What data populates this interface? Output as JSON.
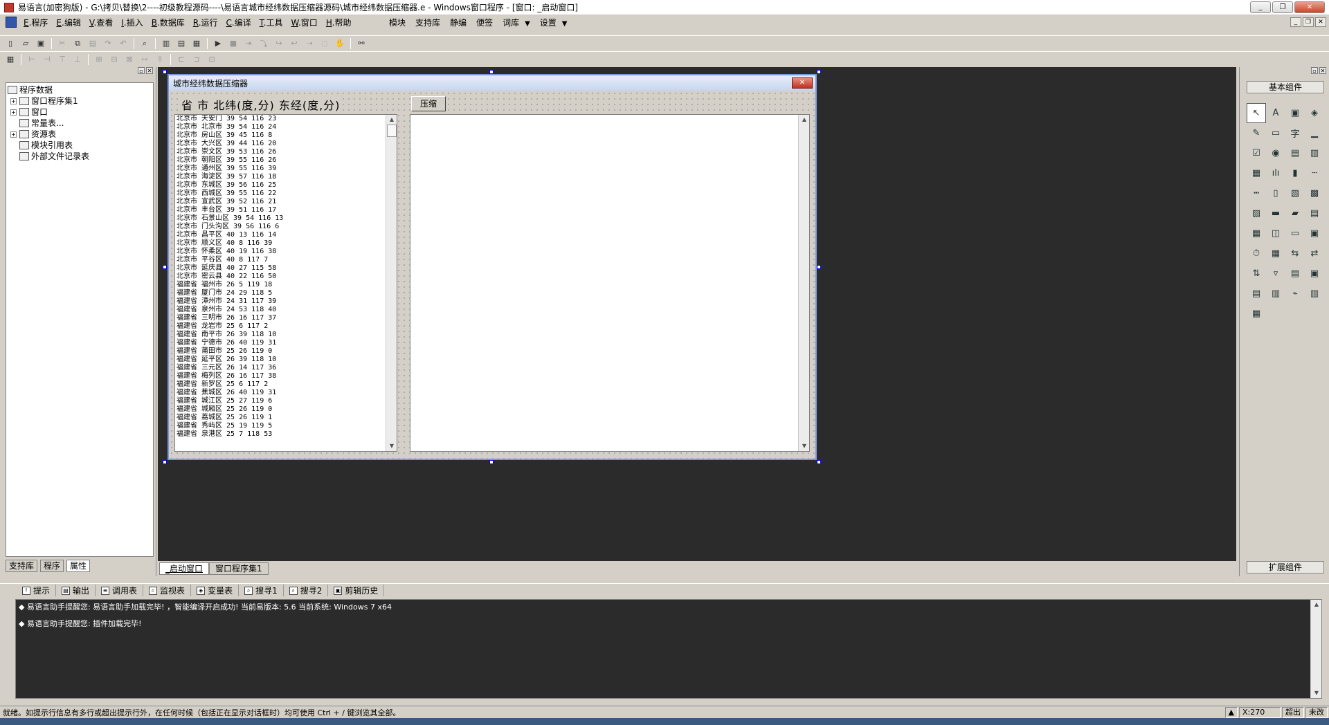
{
  "window": {
    "title": "易语言(加密狗版) - G:\\拷贝\\替换\\2----初级教程源码----\\易语言城市经纬数据压缩器源码\\城市经纬数据压缩器.e - Windows窗口程序 - [窗口: _启动窗口]"
  },
  "menu": {
    "items": [
      {
        "key": "E",
        "label": ".程序"
      },
      {
        "key": "E",
        "label": ".编辑"
      },
      {
        "key": "V",
        "label": ".查看"
      },
      {
        "key": "I",
        "label": ".插入"
      },
      {
        "key": "B",
        "label": ".数据库"
      },
      {
        "key": "R",
        "label": ".运行"
      },
      {
        "key": "C",
        "label": ".编译"
      },
      {
        "key": "T",
        "label": ".工具"
      },
      {
        "key": "W",
        "label": ".窗口"
      },
      {
        "key": "H",
        "label": ".帮助"
      }
    ],
    "right_items": [
      "模块",
      "支持库",
      "静编",
      "便签",
      "词库",
      "设置"
    ]
  },
  "tree": {
    "root": "程序数据",
    "items": [
      {
        "label": "窗口程序集1",
        "expandable": true
      },
      {
        "label": "窗口",
        "expandable": true
      },
      {
        "label": "常量表...",
        "expandable": false
      },
      {
        "label": "资源表",
        "expandable": true
      },
      {
        "label": "模块引用表",
        "expandable": false
      },
      {
        "label": "外部文件记录表",
        "expandable": false
      }
    ]
  },
  "left_tabs": [
    "支持库",
    "程序",
    "属性"
  ],
  "form": {
    "title": "城市经纬数据压缩器",
    "header": "省 市 北纬(度,分) 东经(度,分)",
    "button": "压缩",
    "lines": [
      "北京市 天安门 39 54 116 23",
      "北京市 北京市 39 54 116 24",
      "北京市 房山区 39 45 116 8",
      "北京市 大兴区 39 44 116 20",
      "北京市 崇文区 39 53 116 26",
      "北京市 朝阳区 39 55 116 26",
      "北京市 通州区 39 55 116 39",
      "北京市 海淀区 39 57 116 18",
      "北京市 东城区 39 56 116 25",
      "北京市 西城区 39 55 116 22",
      "北京市 宣武区 39 52 116 21",
      "北京市 丰台区 39 51 116 17",
      "北京市 石景山区 39 54 116 13",
      "北京市 门头沟区 39 56 116 6",
      "北京市 昌平区 40 13 116 14",
      "北京市 顺义区 40 8 116 39",
      "北京市 怀柔区 40 19 116 38",
      "北京市 平谷区 40 8 117 7",
      "北京市 延庆县 40 27 115 58",
      "北京市 密云县 40 22 116 50",
      "福建省 福州市 26 5 119 18",
      "福建省 厦门市 24 29 118 5",
      "福建省 漳州市 24 31 117 39",
      "福建省 泉州市 24 53 118 40",
      "福建省 三明市 26 16 117 37",
      "福建省 龙岩市 25 6 117 2",
      "福建省 南平市 26 39 118 10",
      "福建省 宁德市 26 40 119 31",
      "福建省 莆田市 25 26 119 0",
      "福建省 延平区 26 39 118 10",
      "福建省 三元区 26 14 117 36",
      "福建省 梅列区 26 16 117 38",
      "福建省 新罗区 25 6 117 2",
      "福建省 蕉城区 26 40 119 31",
      "福建省 城江区 25 27 119 6",
      "福建省 城厢区 25 26 119 0",
      "福建省 荔城区 25 26 119 1",
      "福建省 秀屿区 25 19 119 5",
      "福建省 泉港区 25 7 118 53"
    ]
  },
  "doc_tabs": [
    "_启动窗口",
    "窗口程序集1"
  ],
  "right_panel": {
    "basic_label": "基本组件",
    "ext_label": "扩展组件",
    "components": [
      "↖",
      "A",
      "▣",
      "◈",
      "✎",
      "▭",
      "字",
      "▁",
      "☑",
      "◉",
      "▤",
      "▥",
      "▦",
      "ılı",
      "▮",
      "┄",
      "┅",
      "▯",
      "▧",
      "▩",
      "▨",
      "▬",
      "▰",
      "▤",
      "▦",
      "◫",
      "▭",
      "▣",
      "⏱",
      "▦",
      "⇆",
      "⇄",
      "⇅",
      "▿",
      "▤",
      "▣",
      "▤",
      "▥",
      "⌁",
      "▥",
      "▦"
    ]
  },
  "bottom_tabs": [
    "提示",
    "输出",
    "调用表",
    "监视表",
    "变量表",
    "搜寻1",
    "搜寻2",
    "剪辑历史"
  ],
  "output": [
    "◆ 易语言助手提醒您: 易语言助手加载完毕! ，智能编译开启成功! 当前易版本: 5.6 当前系统: Windows 7 x64",
    "◆ 易语言助手提醒您: 插件加载完毕!"
  ],
  "status": {
    "message": "就绪。如提示行信息有多行或超出提示行外，在任何时候（包括正在显示对话框时）均可使用 Ctrl + / 键浏览其全部。",
    "coord": "X:270",
    "overwrite": "超出",
    "recorded": "未改"
  }
}
